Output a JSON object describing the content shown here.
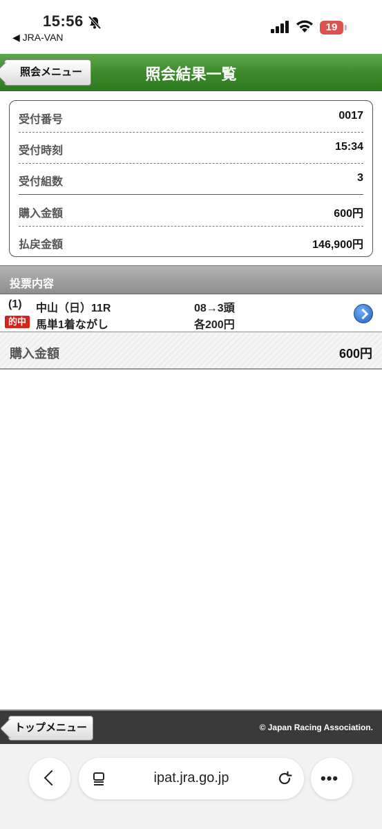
{
  "status_bar": {
    "time": "15:56",
    "back_app": "◀ JRA-VAN",
    "battery": "19"
  },
  "header": {
    "back_label": "照会メニュー",
    "title": "照会結果一覧"
  },
  "info": {
    "rows": [
      {
        "label": "受付番号",
        "value": "0017"
      },
      {
        "label": "受付時刻",
        "value": "15:34"
      },
      {
        "label": "受付組数",
        "value": "3"
      },
      {
        "label": "購入金額",
        "value": "600円"
      },
      {
        "label": "払戻金額",
        "value": "146,900円"
      }
    ]
  },
  "section": {
    "title": "投票内容"
  },
  "bet": {
    "number": "(1)",
    "race": "中山（日）11R",
    "combo": "08→3頭",
    "badge": "的中",
    "type": "馬単1着ながし",
    "amount": "各200円"
  },
  "total": {
    "label": "購入金額",
    "value": "600円"
  },
  "footer": {
    "top_label": "トップメニュー",
    "copyright": "© Japan Racing Association."
  },
  "browser": {
    "url": "ipat.jra.go.jp",
    "more": "•••"
  },
  "colors": {
    "header_green": "#3d8a2c",
    "badge_red": "#d9221a",
    "battery_red": "#d9534f"
  }
}
